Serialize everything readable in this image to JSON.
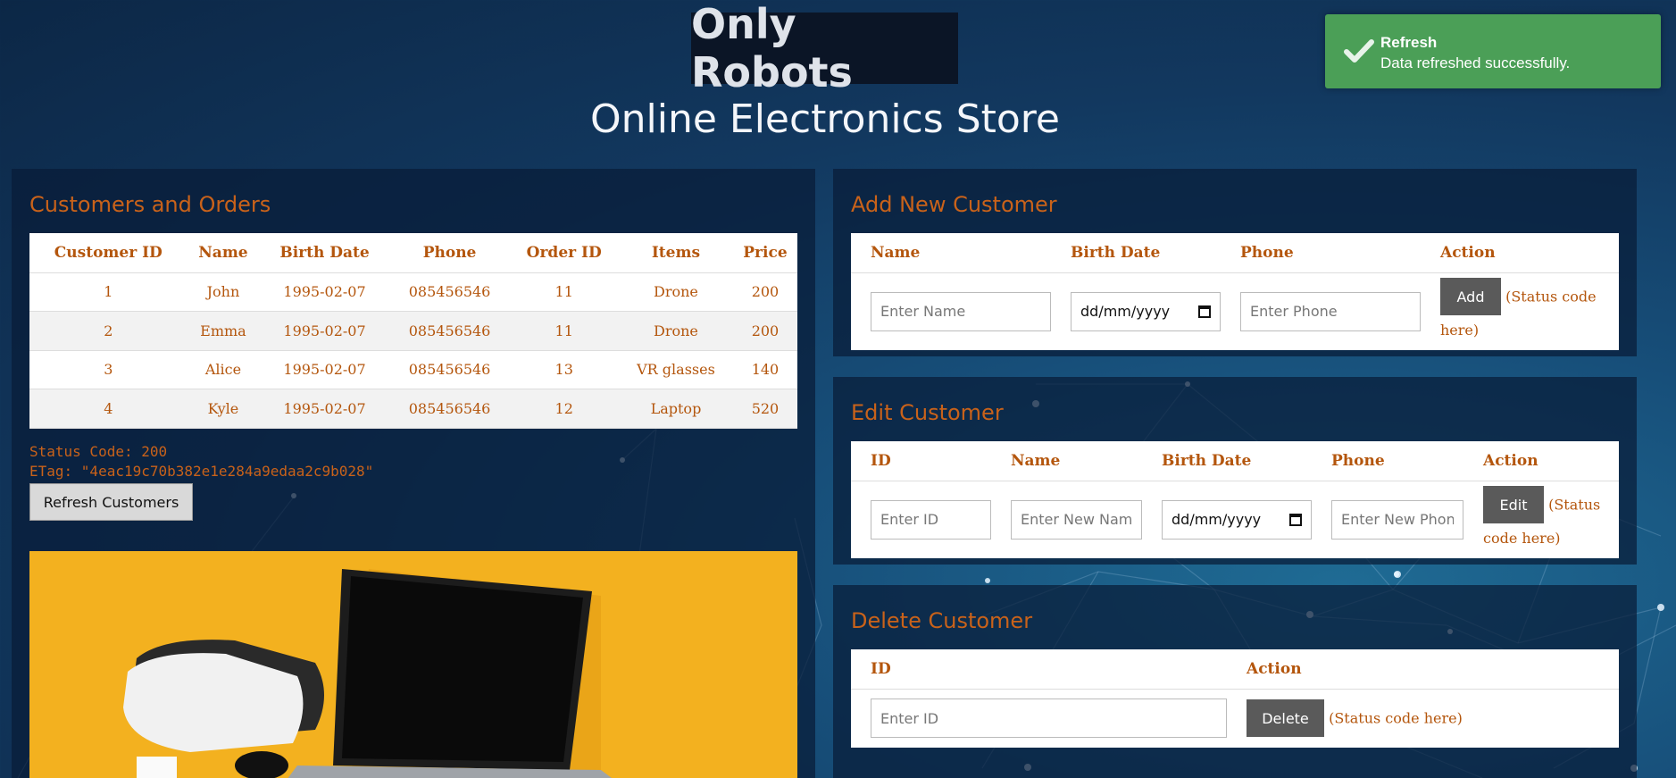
{
  "header": {
    "logo": "Only Robots",
    "subtitle": "Online Electronics Store"
  },
  "toast": {
    "title": "Refresh",
    "message": "Data refreshed successfully.",
    "color": "#4b9f57"
  },
  "customers_panel": {
    "title": "Customers and Orders",
    "columns": [
      "Customer ID",
      "Name",
      "Birth Date",
      "Phone",
      "Order ID",
      "Items",
      "Price"
    ],
    "rows": [
      [
        "1",
        "John",
        "1995-02-07",
        "085456546",
        "11",
        "Drone",
        "200"
      ],
      [
        "2",
        "Emma",
        "1995-02-07",
        "085456546",
        "11",
        "Drone",
        "200"
      ],
      [
        "3",
        "Alice",
        "1995-02-07",
        "085456546",
        "13",
        "VR glasses",
        "140"
      ],
      [
        "4",
        "Kyle",
        "1995-02-07",
        "085456546",
        "12",
        "Laptop",
        "520"
      ]
    ],
    "status_code": "Status Code: 200",
    "etag": "ETag: \"4eac19c70b382e1e284a9edaa2c9b028\"",
    "refresh_label": "Refresh Customers"
  },
  "add_panel": {
    "title": "Add New Customer",
    "columns": [
      "Name",
      "Birth Date",
      "Phone",
      "Action"
    ],
    "name_placeholder": "Enter Name",
    "date_value": "dd/mm/yyyy",
    "phone_placeholder": "Enter Phone",
    "button_label": "Add",
    "status": "(Status code here)"
  },
  "edit_panel": {
    "title": "Edit Customer",
    "columns": [
      "ID",
      "Name",
      "Birth Date",
      "Phone",
      "Action"
    ],
    "id_placeholder": "Enter ID",
    "name_placeholder": "Enter New Name",
    "date_value": "dd/mm/yyyy",
    "phone_placeholder": "Enter New Phone",
    "button_label": "Edit",
    "status": "(Status code here)"
  },
  "delete_panel": {
    "title": "Delete Customer",
    "columns": [
      "ID",
      "Action"
    ],
    "id_placeholder": "Enter ID",
    "button_label": "Delete",
    "status": "(Status code here)"
  },
  "colors": {
    "accent": "#b4560d",
    "panel_title": "#c9621a",
    "button": "#5a5a5a"
  }
}
